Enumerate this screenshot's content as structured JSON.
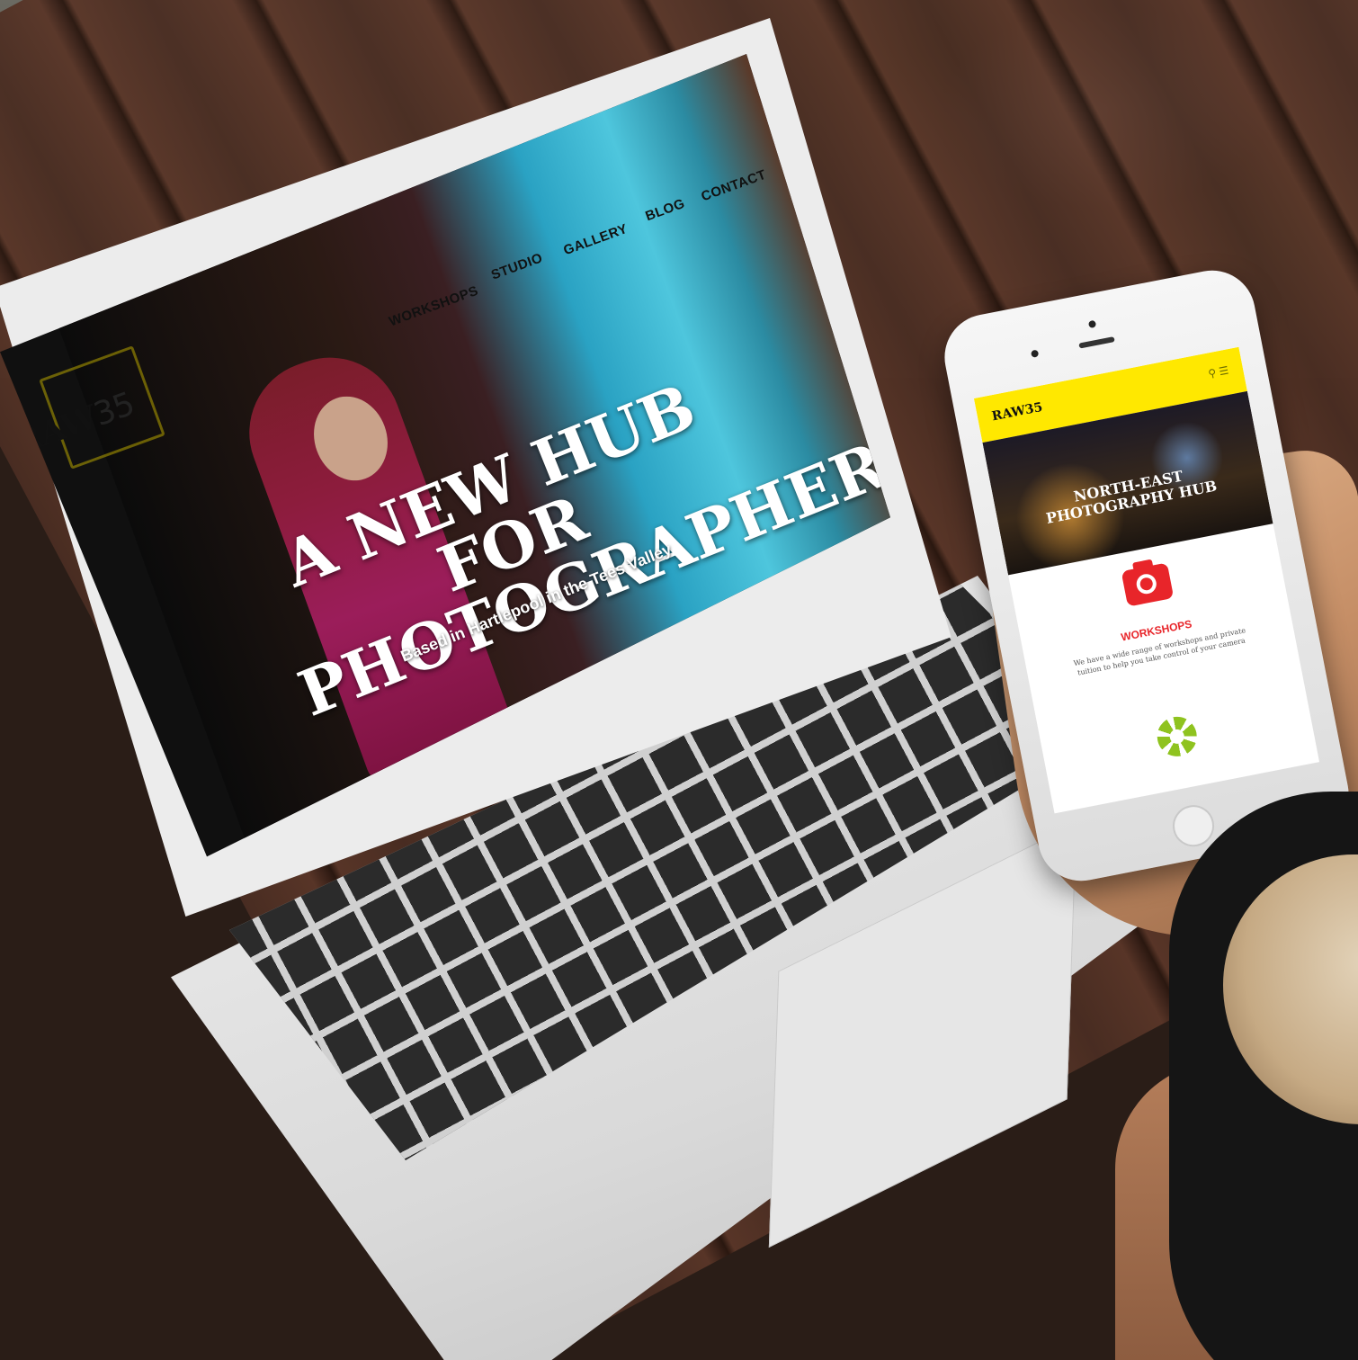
{
  "site": {
    "logo_text": "RAW",
    "logo_number": "35",
    "nav": [
      "WORKSHOPS",
      "STUDIO",
      "GALLERY",
      "BLOG",
      "CONTACT"
    ],
    "hero_title_line1": "A NEW HUB FOR",
    "hero_title_line2": "PHOTOGRAPHERS",
    "hero_subtitle": "Based in Hartlepool in the Tees Valley",
    "brand_color": "#ffe800"
  },
  "mobile": {
    "logo_text": "RAW35",
    "hero_title_line1": "NORTH-EAST",
    "hero_title_line2": "PHOTOGRAPHY HUB",
    "section_title": "WORKSHOPS",
    "section_body": "We have a wide range of workshops and private tuition to help you take control of your camera",
    "icons": [
      "search-icon",
      "menu-icon",
      "camera-icon",
      "aperture-icon"
    ],
    "accent_red": "#e8252a",
    "accent_green": "#8fc31f"
  }
}
